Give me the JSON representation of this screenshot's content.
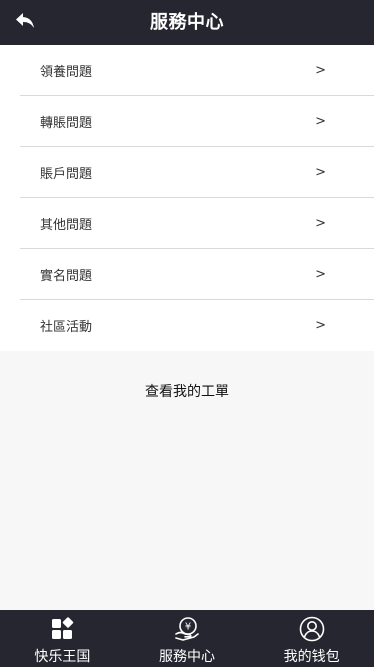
{
  "header": {
    "title": "服務中心",
    "back_icon": "back-arrow-icon"
  },
  "menu": {
    "items": [
      {
        "label": "領養問題",
        "arrow": ">"
      },
      {
        "label": "轉賬問題",
        "arrow": ">"
      },
      {
        "label": "賬戶問題",
        "arrow": ">"
      },
      {
        "label": "其他問題",
        "arrow": ">"
      },
      {
        "label": "實名問題",
        "arrow": ">"
      },
      {
        "label": "社區活動",
        "arrow": ">"
      }
    ]
  },
  "ticket_link": "查看我的工單",
  "tabbar": {
    "tabs": [
      {
        "label": "快乐王国",
        "icon": "apps-grid-icon"
      },
      {
        "label": "服務中心",
        "icon": "hand-coin-icon"
      },
      {
        "label": "我的钱包",
        "icon": "user-circle-icon"
      }
    ]
  },
  "colors": {
    "header_bg": "#262630",
    "page_bg": "#f7f7f7",
    "divider": "#d9d9d9"
  }
}
